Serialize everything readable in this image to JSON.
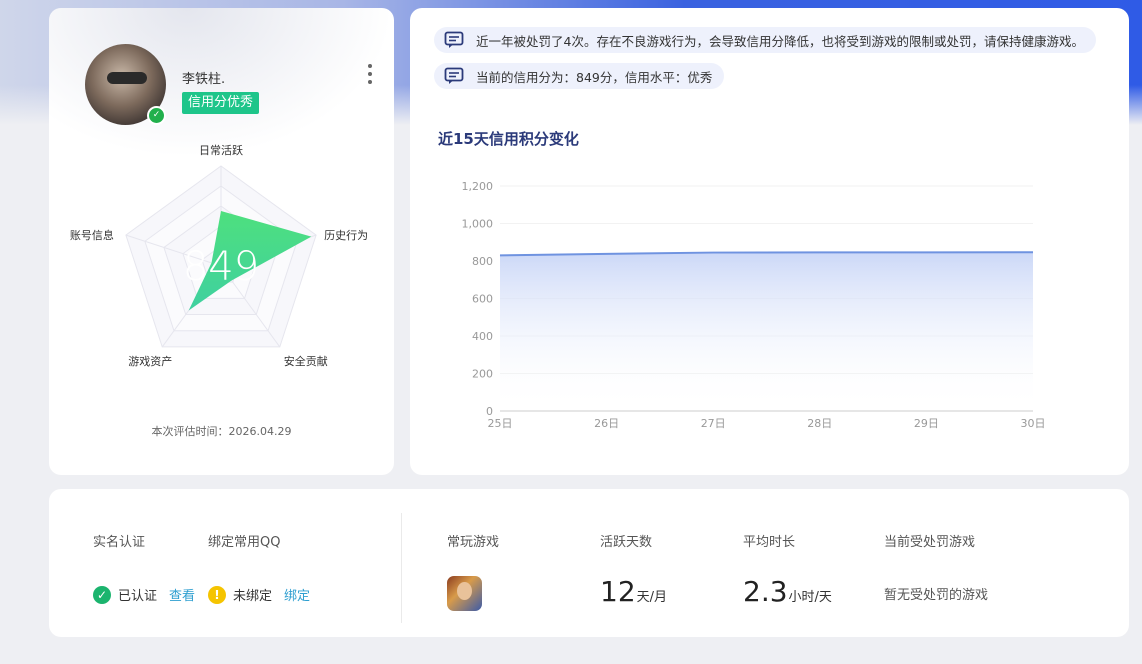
{
  "profile": {
    "name": "李铁柱.",
    "credit_badge": "信用分优秀",
    "radar": {
      "score": "849",
      "axes": [
        "日常活跃",
        "历史行为",
        "安全贡献",
        "游戏资产",
        "账号信息"
      ],
      "values": [
        0.55,
        0.95,
        0.18,
        0.55,
        0.1
      ]
    },
    "eval_time": "本次评估时间：2026.04.29"
  },
  "notices": {
    "penalty": "近一年被处罚了4次。存在不良游戏行为，会导致信用分降低，也将受到游戏的限制或处罚，请保持健康游戏。",
    "current": "当前的信用分为：849分，信用水平：优秀"
  },
  "chart": {
    "title": "近15天信用积分变化"
  },
  "chart_data": {
    "type": "area",
    "title": "近15天信用积分变化",
    "x": [
      "25日",
      "26日",
      "27日",
      "28日",
      "29日",
      "30日"
    ],
    "values": [
      830,
      838,
      845,
      846,
      846,
      847
    ],
    "ylim": [
      0,
      1200
    ],
    "yticks": [
      "0",
      "200",
      "400",
      "600",
      "800",
      "1,000",
      "1,200"
    ],
    "yvalues": [
      0,
      200,
      400,
      600,
      800,
      1000,
      1200
    ],
    "grid": true,
    "color": "#6f93e0"
  },
  "bottom": {
    "realname_label": "实名认证",
    "realname_status": "已认证",
    "realname_link": "查看",
    "qq_label": "绑定常用QQ",
    "qq_status": "未绑定",
    "qq_link": "绑定",
    "game_label": "常玩游戏",
    "active_label": "活跃天数",
    "active_value": "12",
    "active_unit": "天/月",
    "avg_label": "平均时长",
    "avg_value": "2.3",
    "avg_unit": "小时/天",
    "penalty_game_label": "当前受处罚游戏",
    "penalty_game_value": "暂无受处罚的游戏"
  }
}
